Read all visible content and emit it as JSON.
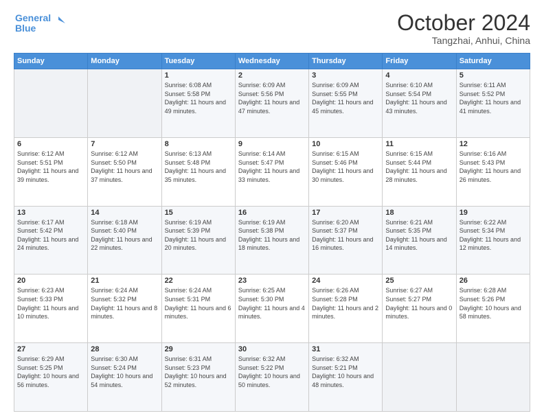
{
  "logo": {
    "line1": "General",
    "line2": "Blue"
  },
  "title": "October 2024",
  "location": "Tangzhai, Anhui, China",
  "days_of_week": [
    "Sunday",
    "Monday",
    "Tuesday",
    "Wednesday",
    "Thursday",
    "Friday",
    "Saturday"
  ],
  "weeks": [
    [
      {
        "num": "",
        "sunrise": "",
        "sunset": "",
        "daylight": ""
      },
      {
        "num": "",
        "sunrise": "",
        "sunset": "",
        "daylight": ""
      },
      {
        "num": "1",
        "sunrise": "Sunrise: 6:08 AM",
        "sunset": "Sunset: 5:58 PM",
        "daylight": "Daylight: 11 hours and 49 minutes."
      },
      {
        "num": "2",
        "sunrise": "Sunrise: 6:09 AM",
        "sunset": "Sunset: 5:56 PM",
        "daylight": "Daylight: 11 hours and 47 minutes."
      },
      {
        "num": "3",
        "sunrise": "Sunrise: 6:09 AM",
        "sunset": "Sunset: 5:55 PM",
        "daylight": "Daylight: 11 hours and 45 minutes."
      },
      {
        "num": "4",
        "sunrise": "Sunrise: 6:10 AM",
        "sunset": "Sunset: 5:54 PM",
        "daylight": "Daylight: 11 hours and 43 minutes."
      },
      {
        "num": "5",
        "sunrise": "Sunrise: 6:11 AM",
        "sunset": "Sunset: 5:52 PM",
        "daylight": "Daylight: 11 hours and 41 minutes."
      }
    ],
    [
      {
        "num": "6",
        "sunrise": "Sunrise: 6:12 AM",
        "sunset": "Sunset: 5:51 PM",
        "daylight": "Daylight: 11 hours and 39 minutes."
      },
      {
        "num": "7",
        "sunrise": "Sunrise: 6:12 AM",
        "sunset": "Sunset: 5:50 PM",
        "daylight": "Daylight: 11 hours and 37 minutes."
      },
      {
        "num": "8",
        "sunrise": "Sunrise: 6:13 AM",
        "sunset": "Sunset: 5:48 PM",
        "daylight": "Daylight: 11 hours and 35 minutes."
      },
      {
        "num": "9",
        "sunrise": "Sunrise: 6:14 AM",
        "sunset": "Sunset: 5:47 PM",
        "daylight": "Daylight: 11 hours and 33 minutes."
      },
      {
        "num": "10",
        "sunrise": "Sunrise: 6:15 AM",
        "sunset": "Sunset: 5:46 PM",
        "daylight": "Daylight: 11 hours and 30 minutes."
      },
      {
        "num": "11",
        "sunrise": "Sunrise: 6:15 AM",
        "sunset": "Sunset: 5:44 PM",
        "daylight": "Daylight: 11 hours and 28 minutes."
      },
      {
        "num": "12",
        "sunrise": "Sunrise: 6:16 AM",
        "sunset": "Sunset: 5:43 PM",
        "daylight": "Daylight: 11 hours and 26 minutes."
      }
    ],
    [
      {
        "num": "13",
        "sunrise": "Sunrise: 6:17 AM",
        "sunset": "Sunset: 5:42 PM",
        "daylight": "Daylight: 11 hours and 24 minutes."
      },
      {
        "num": "14",
        "sunrise": "Sunrise: 6:18 AM",
        "sunset": "Sunset: 5:40 PM",
        "daylight": "Daylight: 11 hours and 22 minutes."
      },
      {
        "num": "15",
        "sunrise": "Sunrise: 6:19 AM",
        "sunset": "Sunset: 5:39 PM",
        "daylight": "Daylight: 11 hours and 20 minutes."
      },
      {
        "num": "16",
        "sunrise": "Sunrise: 6:19 AM",
        "sunset": "Sunset: 5:38 PM",
        "daylight": "Daylight: 11 hours and 18 minutes."
      },
      {
        "num": "17",
        "sunrise": "Sunrise: 6:20 AM",
        "sunset": "Sunset: 5:37 PM",
        "daylight": "Daylight: 11 hours and 16 minutes."
      },
      {
        "num": "18",
        "sunrise": "Sunrise: 6:21 AM",
        "sunset": "Sunset: 5:35 PM",
        "daylight": "Daylight: 11 hours and 14 minutes."
      },
      {
        "num": "19",
        "sunrise": "Sunrise: 6:22 AM",
        "sunset": "Sunset: 5:34 PM",
        "daylight": "Daylight: 11 hours and 12 minutes."
      }
    ],
    [
      {
        "num": "20",
        "sunrise": "Sunrise: 6:23 AM",
        "sunset": "Sunset: 5:33 PM",
        "daylight": "Daylight: 11 hours and 10 minutes."
      },
      {
        "num": "21",
        "sunrise": "Sunrise: 6:24 AM",
        "sunset": "Sunset: 5:32 PM",
        "daylight": "Daylight: 11 hours and 8 minutes."
      },
      {
        "num": "22",
        "sunrise": "Sunrise: 6:24 AM",
        "sunset": "Sunset: 5:31 PM",
        "daylight": "Daylight: 11 hours and 6 minutes."
      },
      {
        "num": "23",
        "sunrise": "Sunrise: 6:25 AM",
        "sunset": "Sunset: 5:30 PM",
        "daylight": "Daylight: 11 hours and 4 minutes."
      },
      {
        "num": "24",
        "sunrise": "Sunrise: 6:26 AM",
        "sunset": "Sunset: 5:28 PM",
        "daylight": "Daylight: 11 hours and 2 minutes."
      },
      {
        "num": "25",
        "sunrise": "Sunrise: 6:27 AM",
        "sunset": "Sunset: 5:27 PM",
        "daylight": "Daylight: 11 hours and 0 minutes."
      },
      {
        "num": "26",
        "sunrise": "Sunrise: 6:28 AM",
        "sunset": "Sunset: 5:26 PM",
        "daylight": "Daylight: 10 hours and 58 minutes."
      }
    ],
    [
      {
        "num": "27",
        "sunrise": "Sunrise: 6:29 AM",
        "sunset": "Sunset: 5:25 PM",
        "daylight": "Daylight: 10 hours and 56 minutes."
      },
      {
        "num": "28",
        "sunrise": "Sunrise: 6:30 AM",
        "sunset": "Sunset: 5:24 PM",
        "daylight": "Daylight: 10 hours and 54 minutes."
      },
      {
        "num": "29",
        "sunrise": "Sunrise: 6:31 AM",
        "sunset": "Sunset: 5:23 PM",
        "daylight": "Daylight: 10 hours and 52 minutes."
      },
      {
        "num": "30",
        "sunrise": "Sunrise: 6:32 AM",
        "sunset": "Sunset: 5:22 PM",
        "daylight": "Daylight: 10 hours and 50 minutes."
      },
      {
        "num": "31",
        "sunrise": "Sunrise: 6:32 AM",
        "sunset": "Sunset: 5:21 PM",
        "daylight": "Daylight: 10 hours and 48 minutes."
      },
      {
        "num": "",
        "sunrise": "",
        "sunset": "",
        "daylight": ""
      },
      {
        "num": "",
        "sunrise": "",
        "sunset": "",
        "daylight": ""
      }
    ]
  ]
}
